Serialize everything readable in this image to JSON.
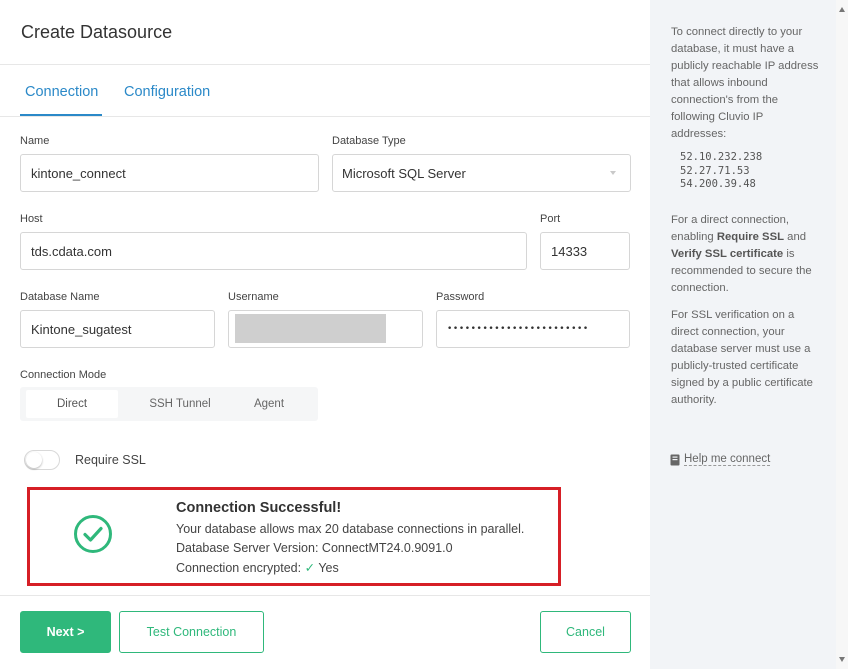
{
  "dialog": {
    "title": "Create Datasource",
    "tabs": [
      {
        "label": "Connection"
      },
      {
        "label": "Configuration"
      }
    ]
  },
  "form": {
    "name": {
      "label": "Name",
      "value": "kintone_connect"
    },
    "database_type": {
      "label": "Database Type",
      "value": "Microsoft SQL Server"
    },
    "host": {
      "label": "Host",
      "value": "tds.cdata.com"
    },
    "port": {
      "label": "Port",
      "value": "14333"
    },
    "database_name": {
      "label": "Database Name",
      "value": "Kintone_sugatest"
    },
    "username": {
      "label": "Username"
    },
    "password": {
      "label": "Password",
      "value": "••••••••••••••••••••••••"
    },
    "connection_mode": {
      "label": "Connection Mode",
      "options": [
        "Direct",
        "SSH Tunnel",
        "Agent"
      ],
      "selected": "Direct"
    },
    "require_ssl": {
      "label": "Require SSL",
      "enabled": false
    }
  },
  "result": {
    "title": "Connection Successful!",
    "line1": "Your database allows max 20 database connections in parallel.",
    "line2": "Database Server Version: ConnectMT24.0.9091.0",
    "line3_prefix": "Connection encrypted:",
    "line3_value": "Yes",
    "highlight_color": "#d61f26",
    "success_color": "#2fb87b"
  },
  "footer": {
    "next_label": "Next >",
    "test_label": "Test Connection",
    "cancel_label": "Cancel"
  },
  "sidebar": {
    "intro": "To connect directly to your database, it must have a publicly reachable IP address that allows inbound connection's from the following Cluvio IP addresses:",
    "ips": [
      "52.10.232.238",
      "52.27.71.53",
      "54.200.39.48"
    ],
    "ssl_text_1": "For a direct connection, enabling",
    "ssl_bold_1": "Require SSL",
    "ssl_text_2": "and",
    "ssl_bold_2": "Verify SSL certificate",
    "ssl_text_3": "is recommended to secure the connection.",
    "verification": "For SSL verification on a direct connection, your database server must use a publicly-trusted certificate signed by a public certificate authority.",
    "help_link": "Help me connect"
  },
  "colors": {
    "accent_blue": "#2b89c8",
    "accent_green": "#2fb87b"
  }
}
